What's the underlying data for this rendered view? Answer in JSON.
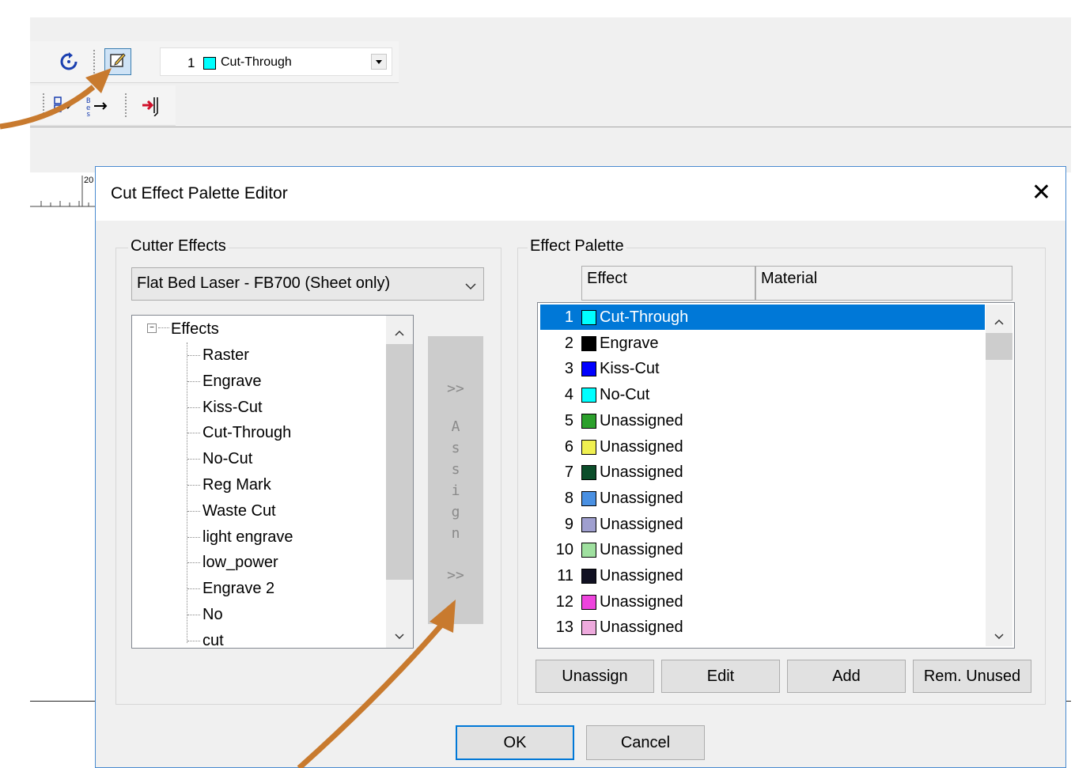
{
  "toolbar": {
    "refresh_icon": "refresh-icon",
    "edit_palette_icon": "edit-icon",
    "effect_combo": {
      "number": "1",
      "color": "#00ffff",
      "label": "Cut-Through"
    }
  },
  "ruler": {
    "tick_label": "20"
  },
  "dialog": {
    "title": "Cut Effect Palette Editor",
    "close_glyph": "✕",
    "cutter_effects": {
      "group_label": "Cutter Effects",
      "device_select": "Flat Bed Laser - FB700 (Sheet only)",
      "tree_root": "Effects",
      "tree_items": [
        "Raster",
        "Engrave",
        "Kiss-Cut",
        "Cut-Through",
        "No-Cut",
        "Reg Mark",
        "Waste Cut",
        "light engrave",
        "low_power",
        "Engrave 2",
        "No",
        "cut"
      ]
    },
    "assign_button": {
      "top": ">>",
      "letters": [
        "A",
        "s",
        "s",
        "i",
        "g",
        "n"
      ],
      "bottom": ">>"
    },
    "effect_palette": {
      "group_label": "Effect Palette",
      "columns": [
        "Effect",
        "Material"
      ],
      "rows": [
        {
          "num": "1",
          "color": "#00ffff",
          "name": "Cut-Through",
          "selected": true
        },
        {
          "num": "2",
          "color": "#000000",
          "name": "Engrave"
        },
        {
          "num": "3",
          "color": "#0000ff",
          "name": "Kiss-Cut"
        },
        {
          "num": "4",
          "color": "#00ffff",
          "name": "No-Cut"
        },
        {
          "num": "5",
          "color": "#2ca02c",
          "name": "Unassigned"
        },
        {
          "num": "6",
          "color": "#f0f050",
          "name": "Unassigned"
        },
        {
          "num": "7",
          "color": "#0b4d2a",
          "name": "Unassigned"
        },
        {
          "num": "8",
          "color": "#4a90e2",
          "name": "Unassigned"
        },
        {
          "num": "9",
          "color": "#9f9fcf",
          "name": "Unassigned"
        },
        {
          "num": "10",
          "color": "#9fe09f",
          "name": "Unassigned"
        },
        {
          "num": "11",
          "color": "#111122",
          "name": "Unassigned"
        },
        {
          "num": "12",
          "color": "#ee44dd",
          "name": "Unassigned"
        },
        {
          "num": "13",
          "color": "#eeaadd",
          "name": "Unassigned"
        }
      ],
      "buttons": [
        "Unassign",
        "Edit",
        "Add",
        "Rem. Unused"
      ]
    },
    "ok_label": "OK",
    "cancel_label": "Cancel"
  },
  "annotation_color": "#c87a2e"
}
